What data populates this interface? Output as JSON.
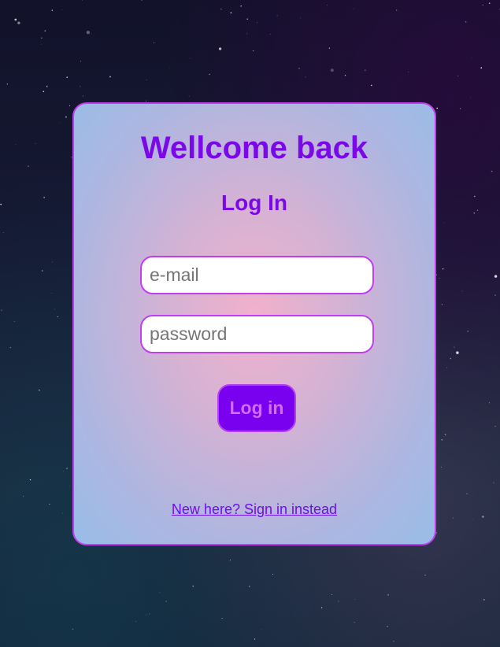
{
  "colors": {
    "accent": "#7a08e8",
    "border": "#c23cf0",
    "button_bg": "#7a00f0",
    "button_text": "#d46cf0",
    "link": "#6d0fe8"
  },
  "login_card": {
    "title": "Wellcome back",
    "subtitle": "Log In",
    "email": {
      "placeholder": "e-mail",
      "value": ""
    },
    "password": {
      "placeholder": "password",
      "value": ""
    },
    "submit_label": "Log in",
    "signup_link": "New here? Sign in instead"
  }
}
